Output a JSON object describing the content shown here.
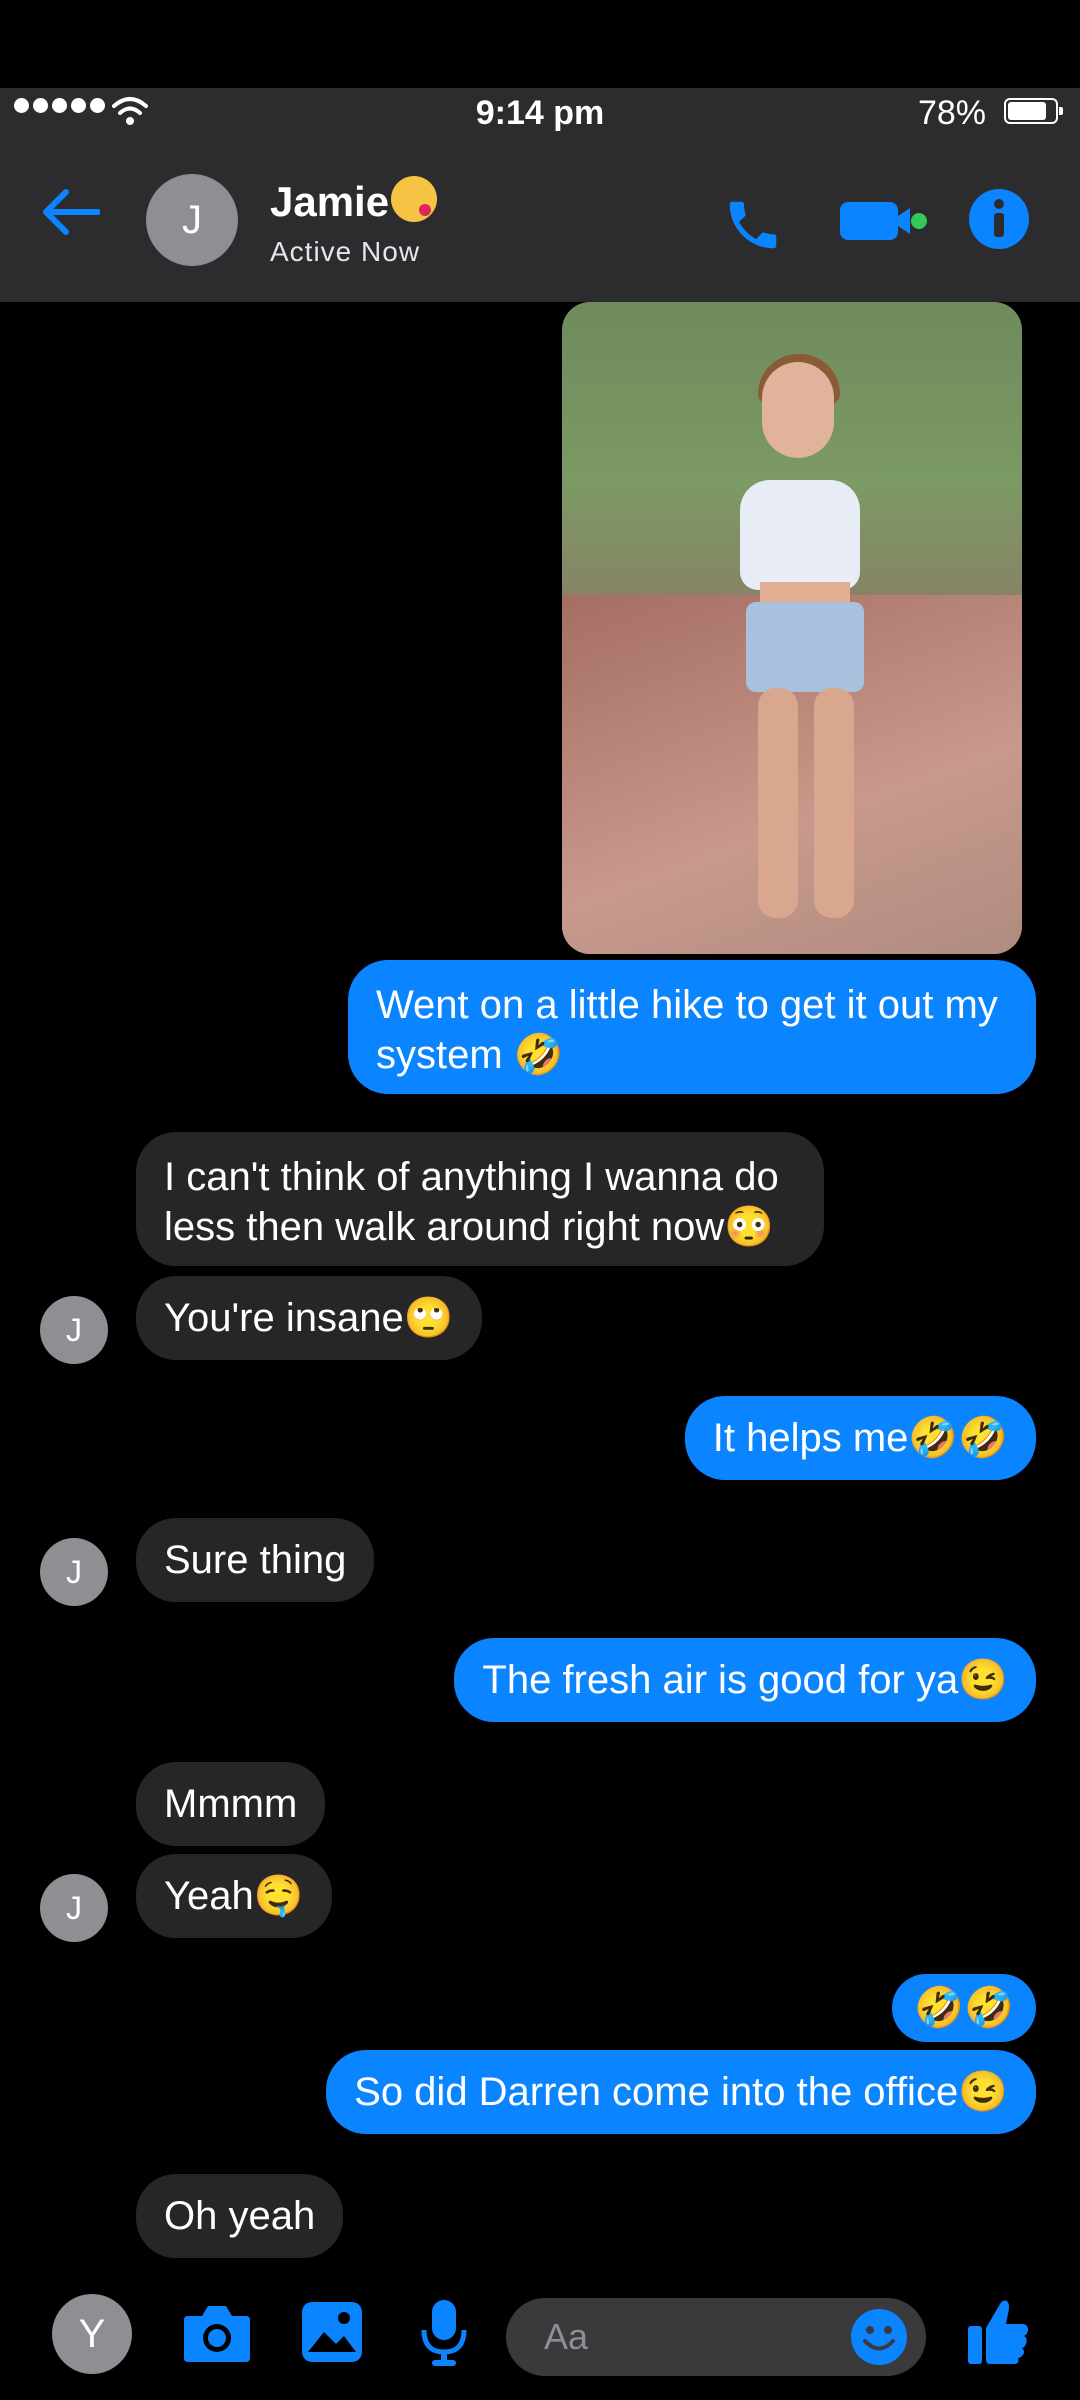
{
  "status_bar": {
    "time": "9:14 pm",
    "battery": "78%",
    "battery_level": 0.78
  },
  "header": {
    "contact_initial": "J",
    "contact_name": "Jamie",
    "status": "Active Now"
  },
  "photo": {
    "description_icon": "photo-attachment"
  },
  "messages": [
    {
      "from": "me",
      "text": "Went on a little hike to get it out my",
      "text2": "system 🤣"
    },
    {
      "from": "them",
      "text": "I can't think of anything I wanna do",
      "text2": "less then walk around right now😳"
    },
    {
      "from": "them",
      "text": "You're insane🙄"
    },
    {
      "from": "me",
      "text": "It helps me🤣🤣"
    },
    {
      "from": "them",
      "text": "Sure thing"
    },
    {
      "from": "me",
      "text": "The fresh air is good for ya😉"
    },
    {
      "from": "them",
      "text": "Mmmm"
    },
    {
      "from": "them",
      "text": "Yeah🤤"
    },
    {
      "from": "me",
      "text": "🤣🤣"
    },
    {
      "from": "me",
      "text": "So did Darren come into the office😉"
    },
    {
      "from": "them",
      "text": "Oh yeah"
    }
  ],
  "avatar_initial": "J",
  "composer": {
    "user_initial": "Y",
    "placeholder": "Aa"
  },
  "colors": {
    "accent": "#0a84ff",
    "incoming_bubble": "#262628",
    "header_bg": "#2c2c2e",
    "online_dot": "#34c759"
  }
}
